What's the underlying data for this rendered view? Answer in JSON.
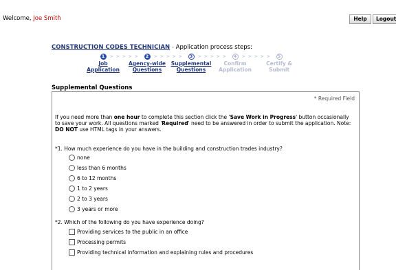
{
  "header": {
    "welcome_prefix": "Welcome,",
    "user_name": "Joe Smith",
    "help_label": "Help",
    "logout_label": "Logout"
  },
  "process": {
    "job_title": "CONSTRUCTION CODES TECHNICIAN",
    "separator": "-",
    "steps_heading": "Application process steps:",
    "steps": [
      {
        "num": "1",
        "line1": "Job",
        "line2": "Application"
      },
      {
        "num": "2",
        "line1": "Agency-wide",
        "line2": "Questions"
      },
      {
        "num": "3",
        "line1": "Supplemental",
        "line2": "Questions"
      },
      {
        "num": "4",
        "line1": "Confirm",
        "line2": "Application"
      },
      {
        "num": "5",
        "line1": "Certify &",
        "line2": "Submit"
      }
    ],
    "arrows": "> > > > >"
  },
  "section": {
    "title": "Supplemental Questions",
    "required_note": "* Required Field",
    "intro": {
      "p1": "If you need more than ",
      "b1": "one hour",
      "p2": " to complete this section click the '",
      "b2": "Save Work in Progress",
      "p3": "' button occasionally to save your work. All questions marked '",
      "b3": "Required",
      "p4": "' need to be answered in order to submit the application. Note: ",
      "b4": "DO NOT",
      "p5": " use HTML tags in your answers."
    }
  },
  "questions": [
    {
      "text": "*1. How much experience do you have in the building and construction trades industry?",
      "options": [
        "none",
        "less than 6 months",
        "6 to 12 months",
        "1 to 2 years",
        "2 to 3 years",
        "3 years or more"
      ]
    },
    {
      "text": "*2. Which of the following do you have experience doing?",
      "options": [
        "Providing services to the public in an office",
        "Processing permits",
        "Providing technical information and explaining rules and procedures"
      ]
    }
  ]
}
